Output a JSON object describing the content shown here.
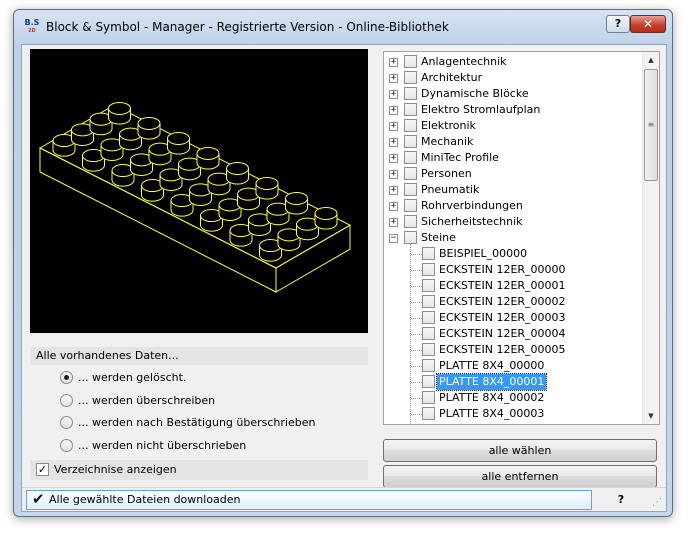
{
  "window": {
    "title": "Block & Symbol - Manager - Registrierte Version - Online-Bibliothek",
    "icon_text": "B.S",
    "icon_subtext": "2D",
    "help_label": "?",
    "close_label": "✕"
  },
  "preview": {
    "background_color": "#000000",
    "line_color": "#ffff33",
    "brick_studs": 32
  },
  "options": {
    "group_label": "Alle vorhandenes Daten...",
    "radios": [
      {
        "label": "... werden gelöscht.",
        "checked": true
      },
      {
        "label": "... werden überschreiben",
        "checked": false
      },
      {
        "label": "... werden nach Bestätigung überschrieben",
        "checked": false
      },
      {
        "label": "... werden nicht überschrieben",
        "checked": false
      }
    ],
    "show_dirs_label": "Verzeichnise anzeigen",
    "show_dirs_checked": true
  },
  "tree": {
    "categories": [
      {
        "label": "Anlagentechnik",
        "expander": "+"
      },
      {
        "label": "Architektur",
        "expander": "+"
      },
      {
        "label": "Dynamische Blöcke",
        "expander": "+"
      },
      {
        "label": "Elektro Stromlaufplan",
        "expander": "+"
      },
      {
        "label": "Elektronik",
        "expander": "+"
      },
      {
        "label": "Mechanik",
        "expander": "+"
      },
      {
        "label": "MiniTec Profile",
        "expander": "+"
      },
      {
        "label": "Personen",
        "expander": "+"
      },
      {
        "label": "Pneumatik",
        "expander": "+"
      },
      {
        "label": "Rohrverbindungen",
        "expander": "+"
      },
      {
        "label": "Sicherheitstechnik",
        "expander": "+"
      },
      {
        "label": "Steine",
        "expander": "−"
      }
    ],
    "children": [
      {
        "label": "BEISPIEL_00000",
        "selected": false
      },
      {
        "label": "ECKSTEIN 12ER_00000",
        "selected": false
      },
      {
        "label": "ECKSTEIN 12ER_00001",
        "selected": false
      },
      {
        "label": "ECKSTEIN 12ER_00002",
        "selected": false
      },
      {
        "label": "ECKSTEIN 12ER_00003",
        "selected": false
      },
      {
        "label": "ECKSTEIN 12ER_00004",
        "selected": false
      },
      {
        "label": "ECKSTEIN 12ER_00005",
        "selected": false
      },
      {
        "label": "PLATTE 8X4_00000",
        "selected": false
      },
      {
        "label": "PLATTE 8X4_00001",
        "selected": true
      },
      {
        "label": "PLATTE 8X4_00002",
        "selected": false
      },
      {
        "label": "PLATTE 8X4_00003",
        "selected": false
      }
    ],
    "scroll_up": "▲",
    "scroll_down": "▼",
    "scroll_grip": "≡",
    "selection_color": "#3399ff"
  },
  "buttons": {
    "select_all": "alle wählen",
    "remove_all": "alle entfernen"
  },
  "status": {
    "check": "✔",
    "text": "Alle gewählte Dateien downloaden",
    "help": "?",
    "grip": "⋰"
  }
}
